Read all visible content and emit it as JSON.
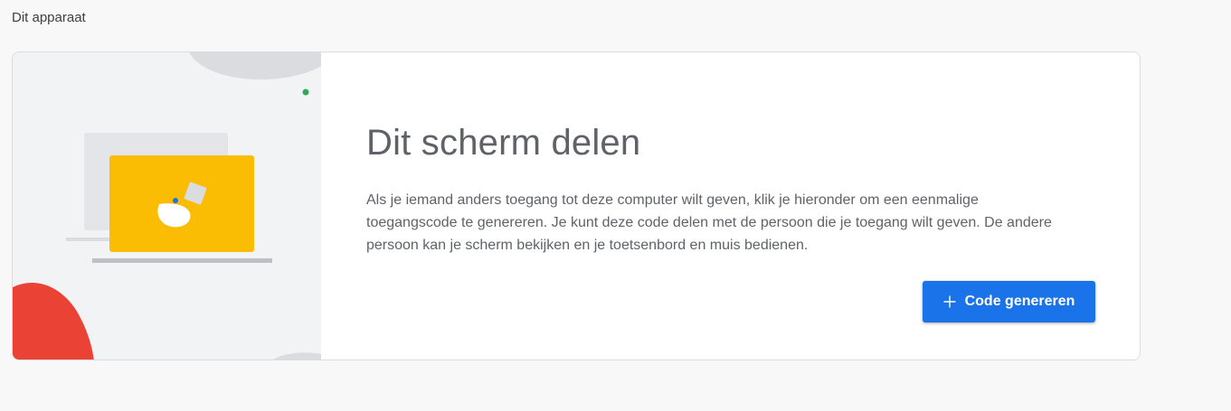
{
  "section": {
    "heading": "Dit apparaat"
  },
  "card": {
    "title": "Dit scherm delen",
    "description": "Als je iemand anders toegang tot deze computer wilt geven, klik je hieronder om een eenmalige toegangscode te genereren. Je kunt deze code delen met de persoon die je toegang wilt geven. De andere persoon kan je scherm bekijken en je toetsenbord en muis bedienen.",
    "button": {
      "label": "Code genereren",
      "icon": "plus-icon"
    }
  },
  "colors": {
    "accent": "#1a73e8",
    "illustration_yellow": "#fbbc04",
    "illustration_red": "#ea4335",
    "illustration_green": "#34a853",
    "illustration_blue": "#1a73e8",
    "illustration_bg": "#f1f3f4"
  }
}
